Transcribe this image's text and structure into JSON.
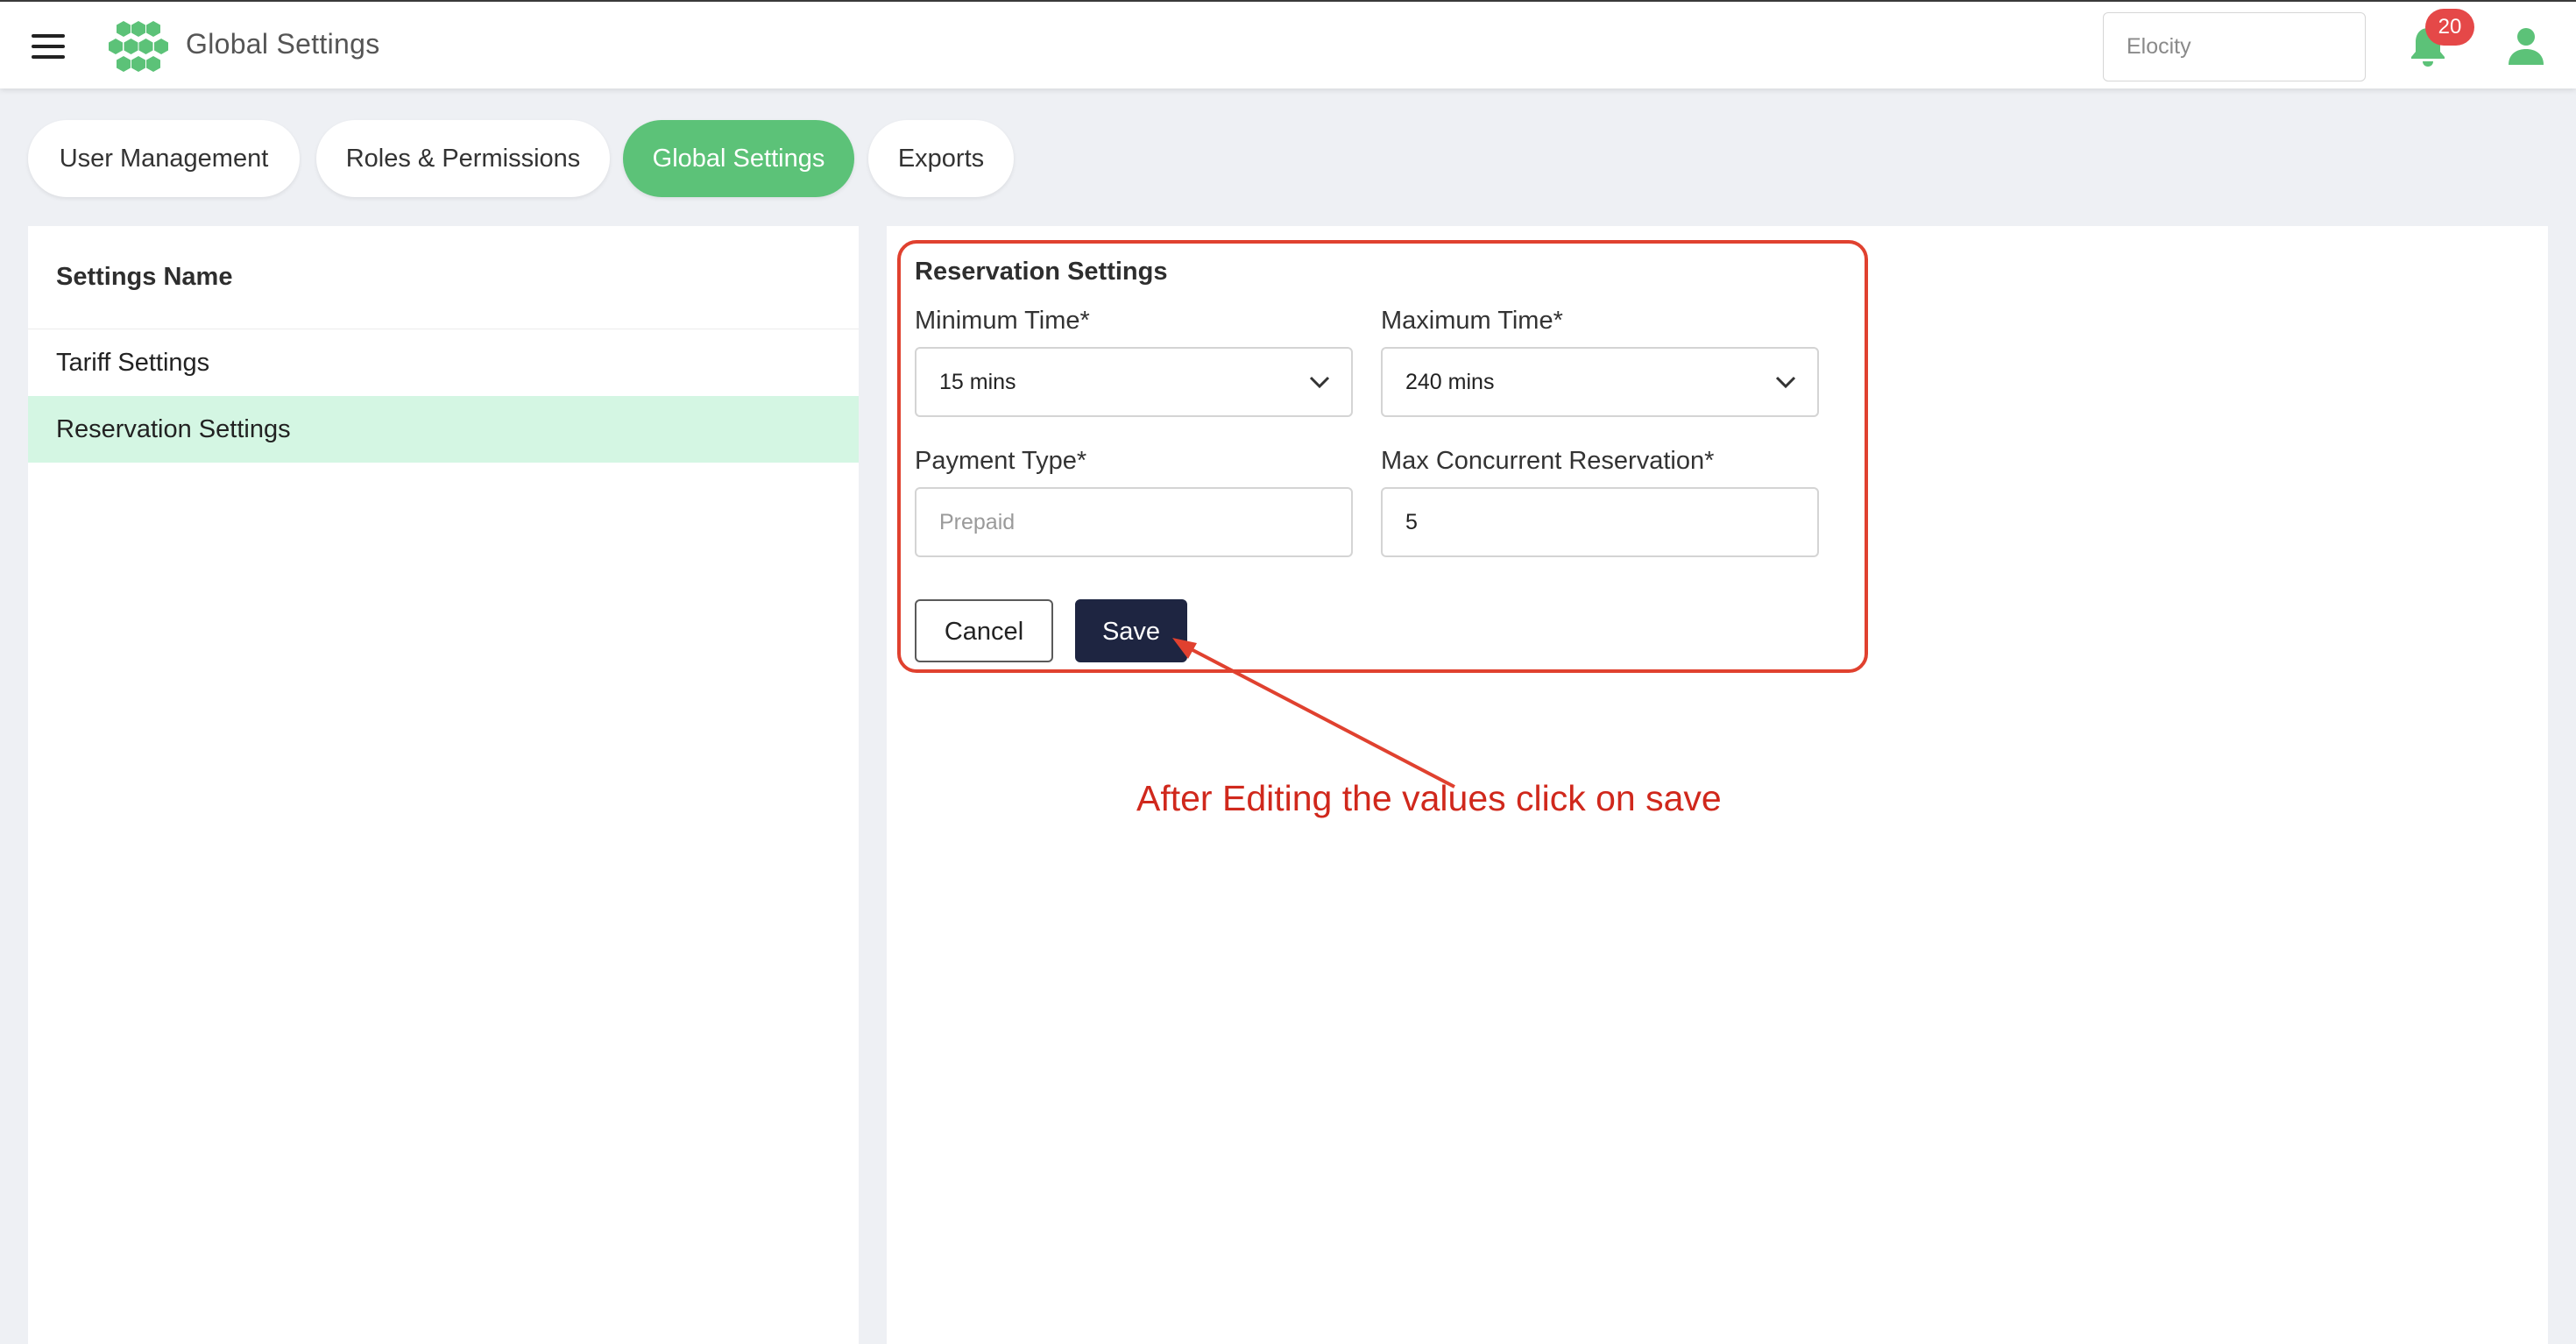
{
  "header": {
    "title": "Global Settings",
    "org_select_value": "Elocity",
    "notification_count": "20"
  },
  "tabs": [
    {
      "label": "User Management",
      "active": false
    },
    {
      "label": "Roles & Permissions",
      "active": false
    },
    {
      "label": "Global Settings",
      "active": true
    },
    {
      "label": "Exports",
      "active": false
    }
  ],
  "settings_list": {
    "header": "Settings Name",
    "items": [
      {
        "label": "Tariff Settings",
        "active": false
      },
      {
        "label": "Reservation Settings",
        "active": true
      }
    ]
  },
  "form": {
    "title": "Reservation Settings",
    "min_time_label": "Minimum Time*",
    "min_time_value": "15 mins",
    "max_time_label": "Maximum Time*",
    "max_time_value": "240 mins",
    "payment_type_label": "Payment Type*",
    "payment_type_placeholder": "Prepaid",
    "max_concurrent_label": "Max Concurrent Reservation*",
    "max_concurrent_value": "5",
    "cancel_label": "Cancel",
    "save_label": "Save"
  },
  "annotation": {
    "text": "After Editing the values click on save"
  },
  "colors": {
    "brand_green": "#5cc278",
    "selected_row_bg": "#d4f6e3",
    "save_button_bg": "#1e2541",
    "badge_red": "#e54848",
    "annotation_red": "#e0412f"
  }
}
